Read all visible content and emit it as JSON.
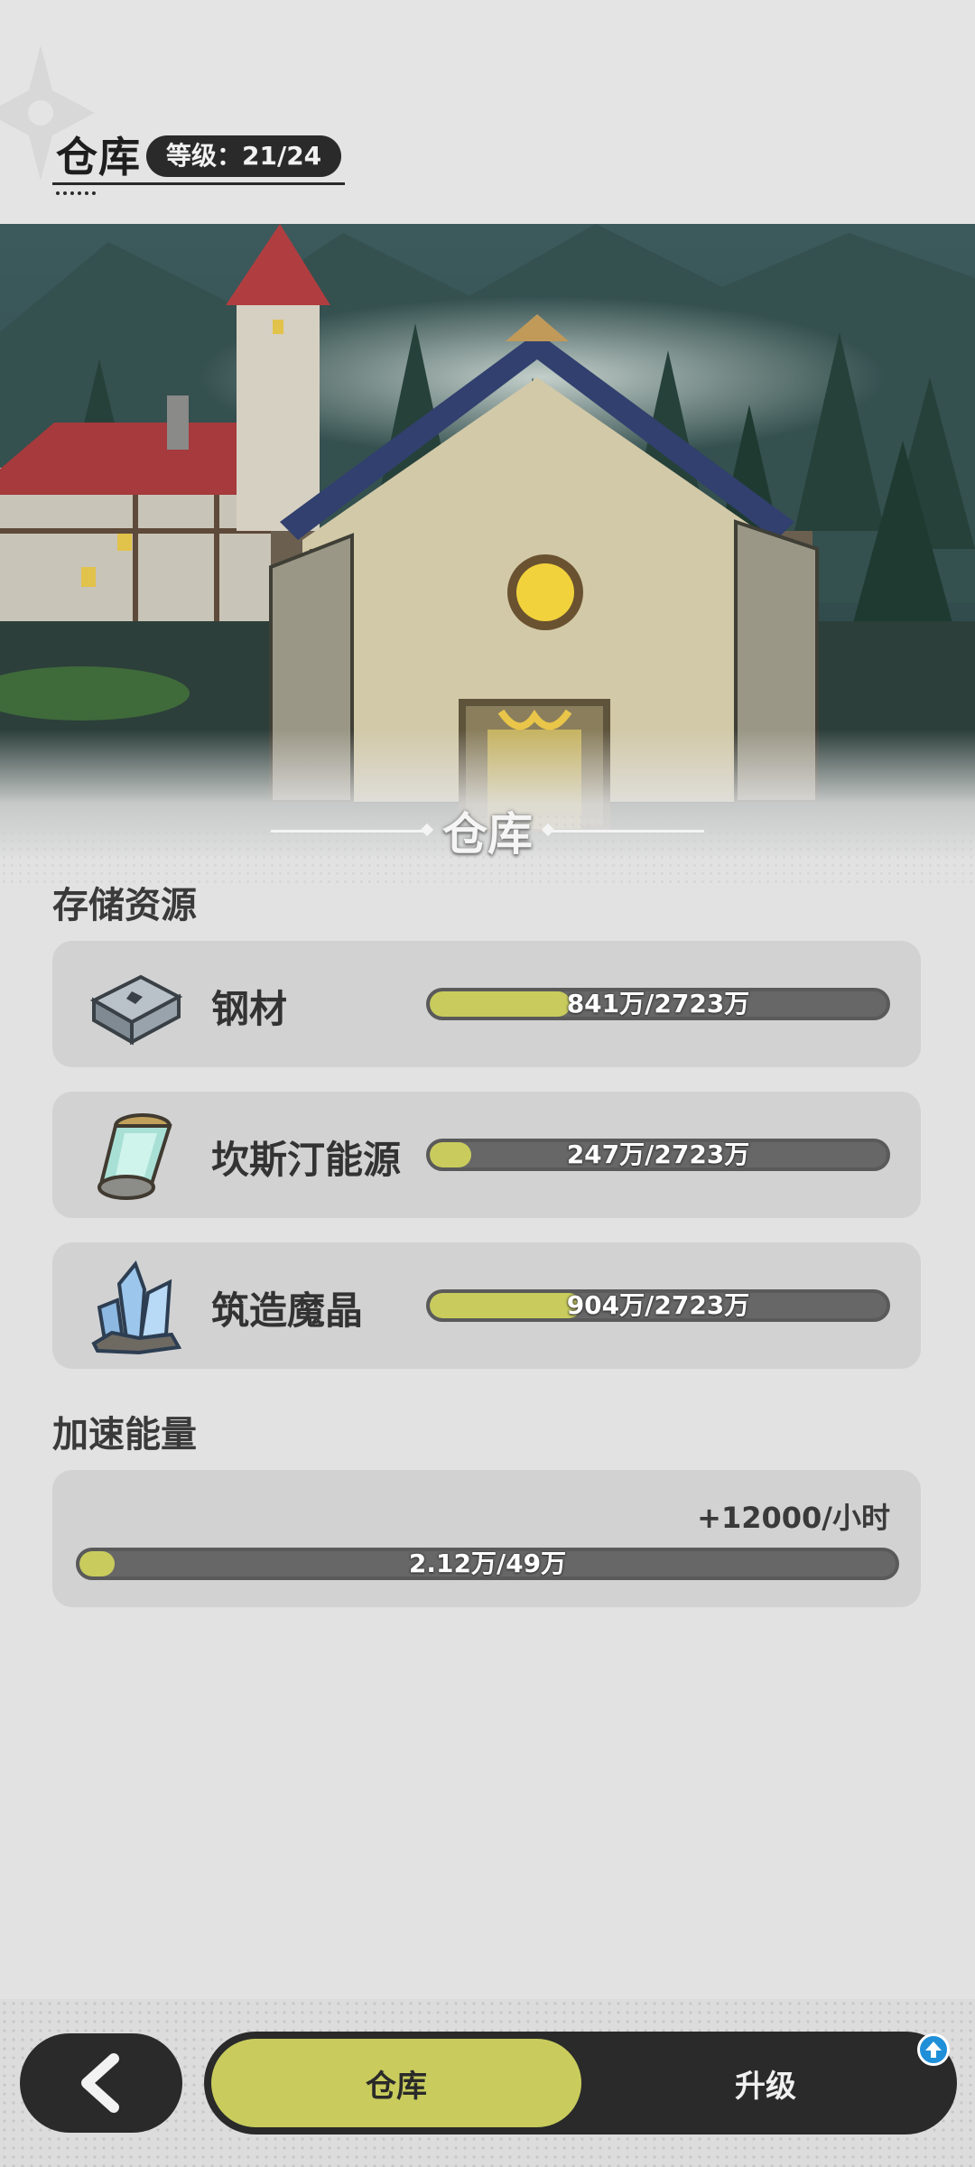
{
  "header": {
    "title": "仓库",
    "level_text": "等级：21/24"
  },
  "banner": {
    "title": "仓库"
  },
  "storage": {
    "section_title": "存储资源",
    "items": [
      {
        "name": "钢材",
        "icon": "steel-icon",
        "current": 841,
        "max": 2723,
        "progress_text": "841万/2723万"
      },
      {
        "name": "坎斯汀能源",
        "icon": "energy-canister-icon",
        "current": 247,
        "max": 2723,
        "progress_text": "247万/2723万"
      },
      {
        "name": "筑造魔晶",
        "icon": "crystal-icon",
        "current": 904,
        "max": 2723,
        "progress_text": "904万/2723万"
      }
    ]
  },
  "accel": {
    "section_title": "加速能量",
    "rate_text": "+12000/小时",
    "current": 2.12,
    "max": 49,
    "progress_text": "2.12万/49万"
  },
  "bottom": {
    "back_icon": "back-arrow-icon",
    "tab_active": "仓库",
    "tab_upgrade": "升级",
    "badge_icon": "upgrade-arrow-icon"
  },
  "colors": {
    "accent": "#c9cc5c",
    "bar_track": "#676767",
    "dark": "#2a2a2a",
    "badge": "#1f8fd8"
  }
}
